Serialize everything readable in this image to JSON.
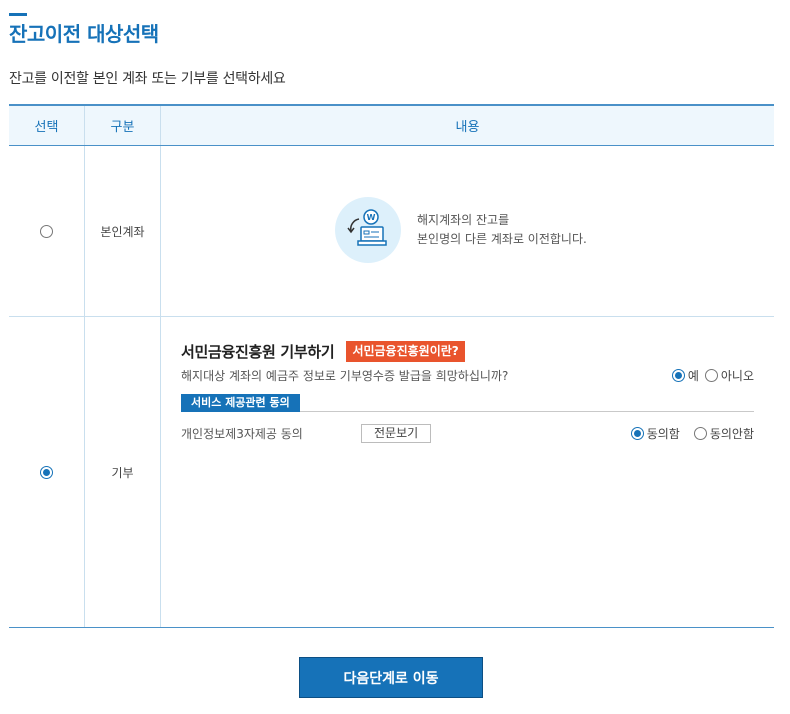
{
  "header": {
    "title": "잔고이전 대상선택",
    "description": "잔고를 이전할 본인 계좌 또는 기부를 선택하세요"
  },
  "table": {
    "columns": [
      "선택",
      "구분",
      "내용"
    ],
    "rows": [
      {
        "category": "본인계좌",
        "selected": false,
        "content_lines": [
          "해지계좌의 잔고를",
          "본인명의 다른 계좌로 이전합니다."
        ],
        "icon": "wallet-transfer-icon"
      },
      {
        "category": "기부",
        "selected": true,
        "donate_title": "서민금융진흥원 기부하기",
        "what_button": "서민금융진흥원이란?",
        "question": "해지대상 계좌의 예금주 정보로 기부영수증 발급을 희망하십니까?",
        "yes_label": "예",
        "no_label": "아니오",
        "receipt_yes_selected": true,
        "service_tag": "서비스 제공관련 동의",
        "consent_label": "개인정보제3자제공 동의",
        "view_button": "전문보기",
        "agree_label": "동의함",
        "disagree_label": "동의안함",
        "agree_selected": true
      }
    ]
  },
  "footer": {
    "next_button": "다음단계로 이동"
  },
  "colors": {
    "accent": "#1672b8",
    "header_bg": "#eef7fd",
    "highlight": "#e9542d",
    "icon_bg": "#ddf0fb"
  }
}
